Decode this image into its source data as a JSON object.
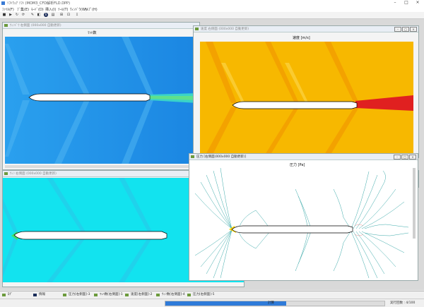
{
  "app": {
    "title": "ｿﾌﾄｳｪｱ  ｿﾌﾄ  (MOM3_CFD解析FLD.DPP)",
    "window_controls": [
      "–",
      "□",
      "×"
    ]
  },
  "menu": [
    "ﾌｧｲﾙ(F)",
    "ﾌﾞ集(E)",
    "ﾓｰﾄﾞ(D)",
    "挿入(I)",
    "ﾂｰﾙ(T)",
    "ｳｨﾝﾄﾞｳ(W)",
    "ﾍﾙﾌﾟ(H)"
  ],
  "toolbar": [
    "■",
    "▶",
    "↻",
    "⟳",
    "✎",
    "◧",
    "ℹ",
    "▤",
    "⊞",
    "⊡",
    "⇩"
  ],
  "windows": {
    "density": {
      "title": "ｳｨﾝﾄﾞｳ 右側面 (000x000 自動更新)",
      "plot_title": "ﾏｯﾊ数"
    },
    "velocity": {
      "title": "速度 右側面 (000x000 自動更新)",
      "plot_title": "速度 [m/s]"
    },
    "lower_left": {
      "title": "ｳｨﾝ 右側面 (000x000 自動更新)"
    },
    "lower_right_hidden": {
      "title": "ｳｨﾝ 右側面 (000x000 自動更新)"
    },
    "pressure": {
      "title": "圧力 [右側面(000x000 自動更新)]",
      "plot_title": "圧力 [Pa]"
    }
  },
  "taskbar_tabs": [
    {
      "label": "ﾛｸﾞ"
    },
    {
      "label": "情報"
    },
    {
      "label": "圧力[右側面]-3"
    },
    {
      "label": "ﾏｯﾊ数[右側面]-1"
    },
    {
      "label": "速度[右側面]-2"
    },
    {
      "label": "ｳｨﾝ数[右側面]-4"
    },
    {
      "label": "圧力[右側面]-5"
    }
  ],
  "status": {
    "progress_fraction": 0.55,
    "progress_label": "計算",
    "right_text": "実行回数 : 4/100"
  },
  "colors": {
    "mach_bg": "#1e8fe8",
    "velocity_bg": "#f5b400",
    "cyan_bg": "#11e6f0",
    "pressure_line": "#34a6a6"
  }
}
